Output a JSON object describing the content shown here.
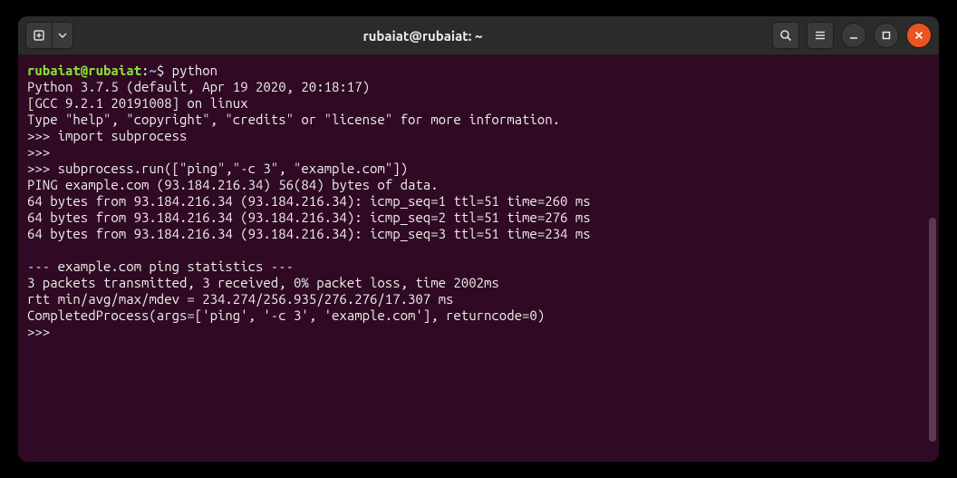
{
  "titlebar": {
    "title": "rubaiat@rubaiat: ~"
  },
  "terminal": {
    "prompt_user": "rubaiat@rubaiat",
    "prompt_sep": ":",
    "prompt_path": "~",
    "prompt_dollar": "$ ",
    "cmd": "python",
    "lines": [
      "Python 3.7.5 (default, Apr 19 2020, 20:18:17)",
      "[GCC 9.2.1 20191008] on linux",
      "Type \"help\", \"copyright\", \"credits\" or \"license\" for more information.",
      ">>> import subprocess",
      ">>>",
      ">>> subprocess.run([\"ping\",\"-c 3\", \"example.com\"])",
      "PING example.com (93.184.216.34) 56(84) bytes of data.",
      "64 bytes from 93.184.216.34 (93.184.216.34): icmp_seq=1 ttl=51 time=260 ms",
      "64 bytes from 93.184.216.34 (93.184.216.34): icmp_seq=2 ttl=51 time=276 ms",
      "64 bytes from 93.184.216.34 (93.184.216.34): icmp_seq=3 ttl=51 time=234 ms",
      "",
      "--- example.com ping statistics ---",
      "3 packets transmitted, 3 received, 0% packet loss, time 2002ms",
      "rtt min/avg/max/mdev = 234.274/256.935/276.276/17.307 ms",
      "CompletedProcess(args=['ping', '-c 3', 'example.com'], returncode=0)",
      ">>>"
    ]
  }
}
